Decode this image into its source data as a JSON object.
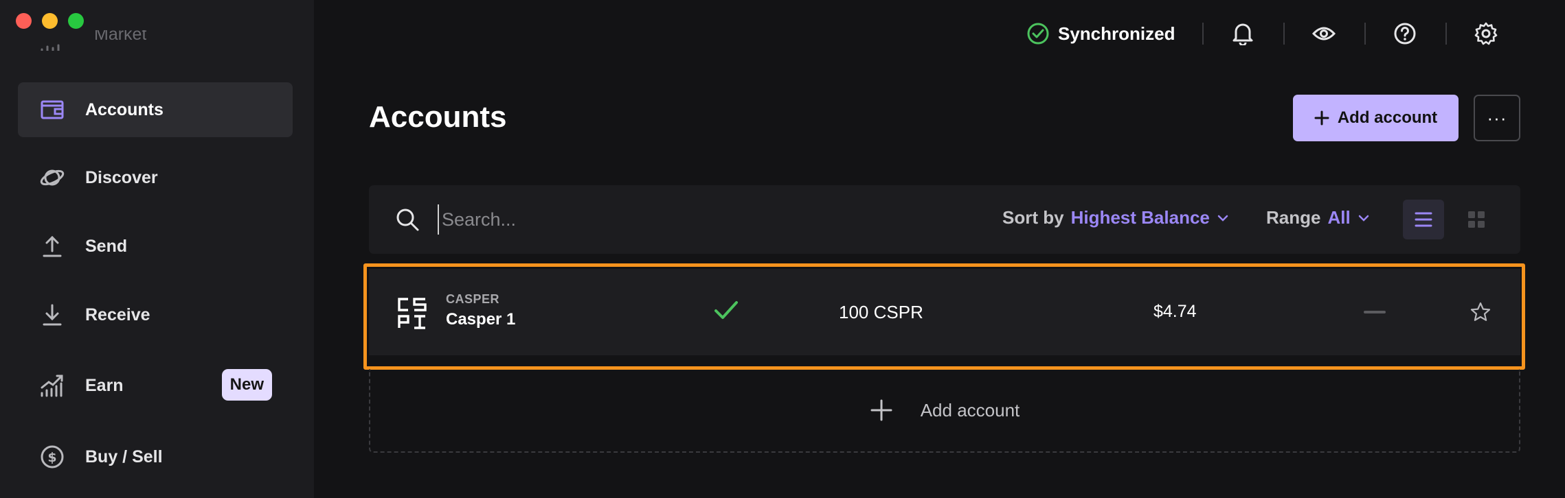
{
  "sidebar": {
    "cut_item": {
      "label": "Market"
    },
    "items": [
      {
        "id": "accounts",
        "label": "Accounts",
        "icon": "wallet-icon",
        "active": true
      },
      {
        "id": "discover",
        "label": "Discover",
        "icon": "planet-icon"
      },
      {
        "id": "send",
        "label": "Send",
        "icon": "upload-icon"
      },
      {
        "id": "receive",
        "label": "Receive",
        "icon": "download-icon"
      },
      {
        "id": "earn",
        "label": "Earn",
        "icon": "growth-icon",
        "badge": "New"
      },
      {
        "id": "buysell",
        "label": "Buy / Sell",
        "icon": "dollar-circle-icon"
      }
    ]
  },
  "topbar": {
    "sync_status": "Synchronized",
    "icons": [
      "bell-icon",
      "eye-icon",
      "help-icon",
      "gear-icon"
    ]
  },
  "main": {
    "title": "Accounts",
    "add_account_label": "Add account",
    "more_label": "···",
    "search": {
      "placeholder": "Search...",
      "value": ""
    },
    "sort": {
      "label": "Sort by",
      "value": "Highest Balance"
    },
    "range": {
      "label": "Range",
      "value": "All"
    },
    "accounts": [
      {
        "currency": "CASPER",
        "name": "Casper 1",
        "synced": true,
        "balance": "100 CSPR",
        "fiat": "$4.74",
        "change": "—",
        "starred": false
      }
    ],
    "add_row_label": "Add account"
  },
  "colors": {
    "accent": "#9b87f5",
    "button_primary": "#c2b3ff",
    "highlight": "#f5931e",
    "success": "#4cc35e"
  }
}
